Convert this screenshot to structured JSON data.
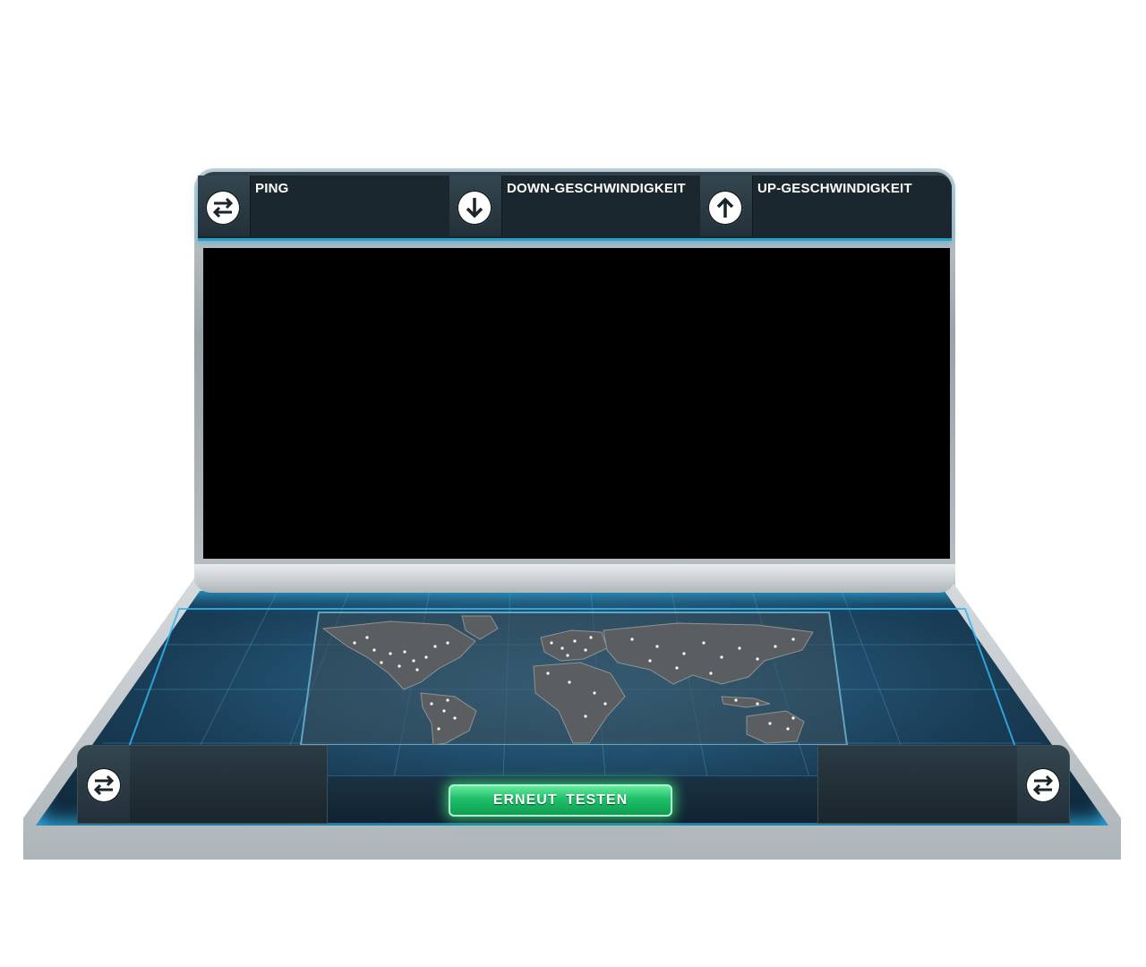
{
  "metrics": {
    "ping": {
      "label": "PING",
      "value": "",
      "icon": "swap-arrows-icon"
    },
    "download": {
      "label": "DOWN-GESCHWINDIGKEIT",
      "value": "",
      "icon": "arrow-down-icon"
    },
    "upload": {
      "label": "UP-GESCHWINDIGKEIT",
      "value": "",
      "icon": "arrow-up-icon"
    }
  },
  "left_panel": {
    "icon": "swap-arrows-icon",
    "text": ""
  },
  "right_panel": {
    "icon": "swap-arrows-icon",
    "text": ""
  },
  "retest_button": {
    "label": "ERNEUT  TESTEN"
  },
  "colors": {
    "accent_blue": "#2fb6ee",
    "button_green": "#1fbf6a",
    "panel_dark": "#1b272e"
  }
}
